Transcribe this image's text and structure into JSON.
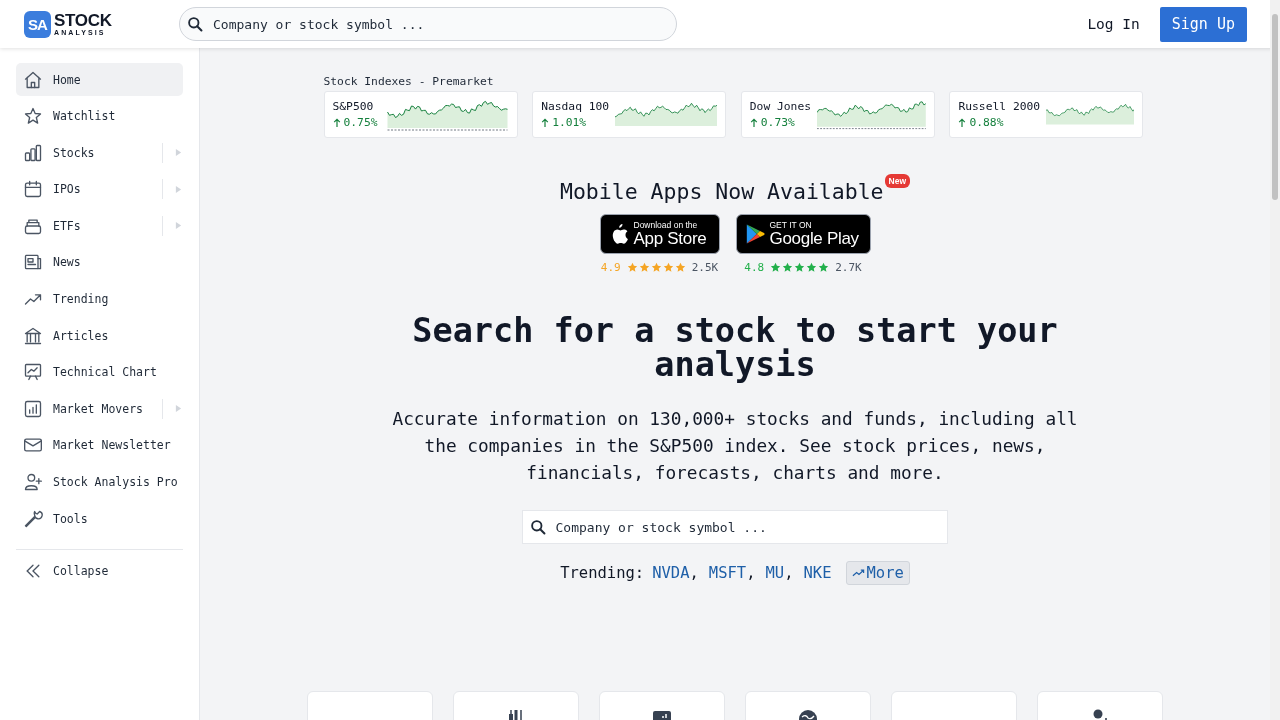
{
  "header": {
    "logo_mark": "SA",
    "logo_top": "STOCK",
    "logo_bottom": "ANALYSIS",
    "search": {
      "placeholder": "Company or stock symbol ..."
    },
    "login": "Log In",
    "signup": "Sign Up"
  },
  "sidebar": {
    "items": [
      {
        "label": "Home",
        "selected": true,
        "expandable": false
      },
      {
        "label": "Watchlist",
        "selected": false,
        "expandable": false
      },
      {
        "label": "Stocks",
        "selected": false,
        "expandable": true
      },
      {
        "label": "IPOs",
        "selected": false,
        "expandable": true
      },
      {
        "label": "ETFs",
        "selected": false,
        "expandable": true
      },
      {
        "label": "News",
        "selected": false,
        "expandable": false
      },
      {
        "label": "Trending",
        "selected": false,
        "expandable": false
      },
      {
        "label": "Articles",
        "selected": false,
        "expandable": false
      },
      {
        "label": "Technical Chart",
        "selected": false,
        "expandable": false
      },
      {
        "label": "Market Movers",
        "selected": false,
        "expandable": true
      },
      {
        "label": "Market Newsletter",
        "selected": false,
        "expandable": false
      },
      {
        "label": "Stock Analysis Pro",
        "selected": false,
        "expandable": false
      },
      {
        "label": "Tools",
        "selected": false,
        "expandable": false
      }
    ],
    "collapse": "Collapse"
  },
  "indexes": {
    "title": "Stock Indexes - Premarket",
    "items": [
      {
        "name": "S&P500",
        "change": "0.75%",
        "baseline_visible": true
      },
      {
        "name": "Nasdaq 100",
        "change": "1.01%",
        "baseline_visible": false
      },
      {
        "name": "Dow Jones",
        "change": "0.73%",
        "baseline_visible": true
      },
      {
        "name": "Russell 2000",
        "change": "0.88%",
        "baseline_visible": false
      }
    ]
  },
  "apps": {
    "title": "Mobile Apps Now Available",
    "badge": "New",
    "stores": [
      {
        "kind": "apple",
        "line1": "Download on the",
        "line2": "App Store",
        "rating": "4.9",
        "stars": 5,
        "count": "2.5K",
        "color": "#f5a524"
      },
      {
        "kind": "google",
        "line1": "GET IT ON",
        "line2": "Google Play",
        "rating": "4.8",
        "stars": 5,
        "count": "2.7K",
        "color": "#22b04b"
      }
    ]
  },
  "hero": {
    "headline": "Search for a stock to start your analysis",
    "text": "Accurate information on 130,000+ stocks and funds, including all the companies in the S&P500 index. See stock prices, news, financials, forecasts, charts and more.",
    "search": {
      "placeholder": "Company or stock symbol ..."
    },
    "trending_label": "Trending:",
    "tickers": [
      {
        "symbol": "NVDA",
        "separator": ","
      },
      {
        "symbol": "MSFT",
        "separator": ","
      },
      {
        "symbol": "MU",
        "separator": ","
      },
      {
        "symbol": "NKE"
      }
    ],
    "more": "More"
  }
}
